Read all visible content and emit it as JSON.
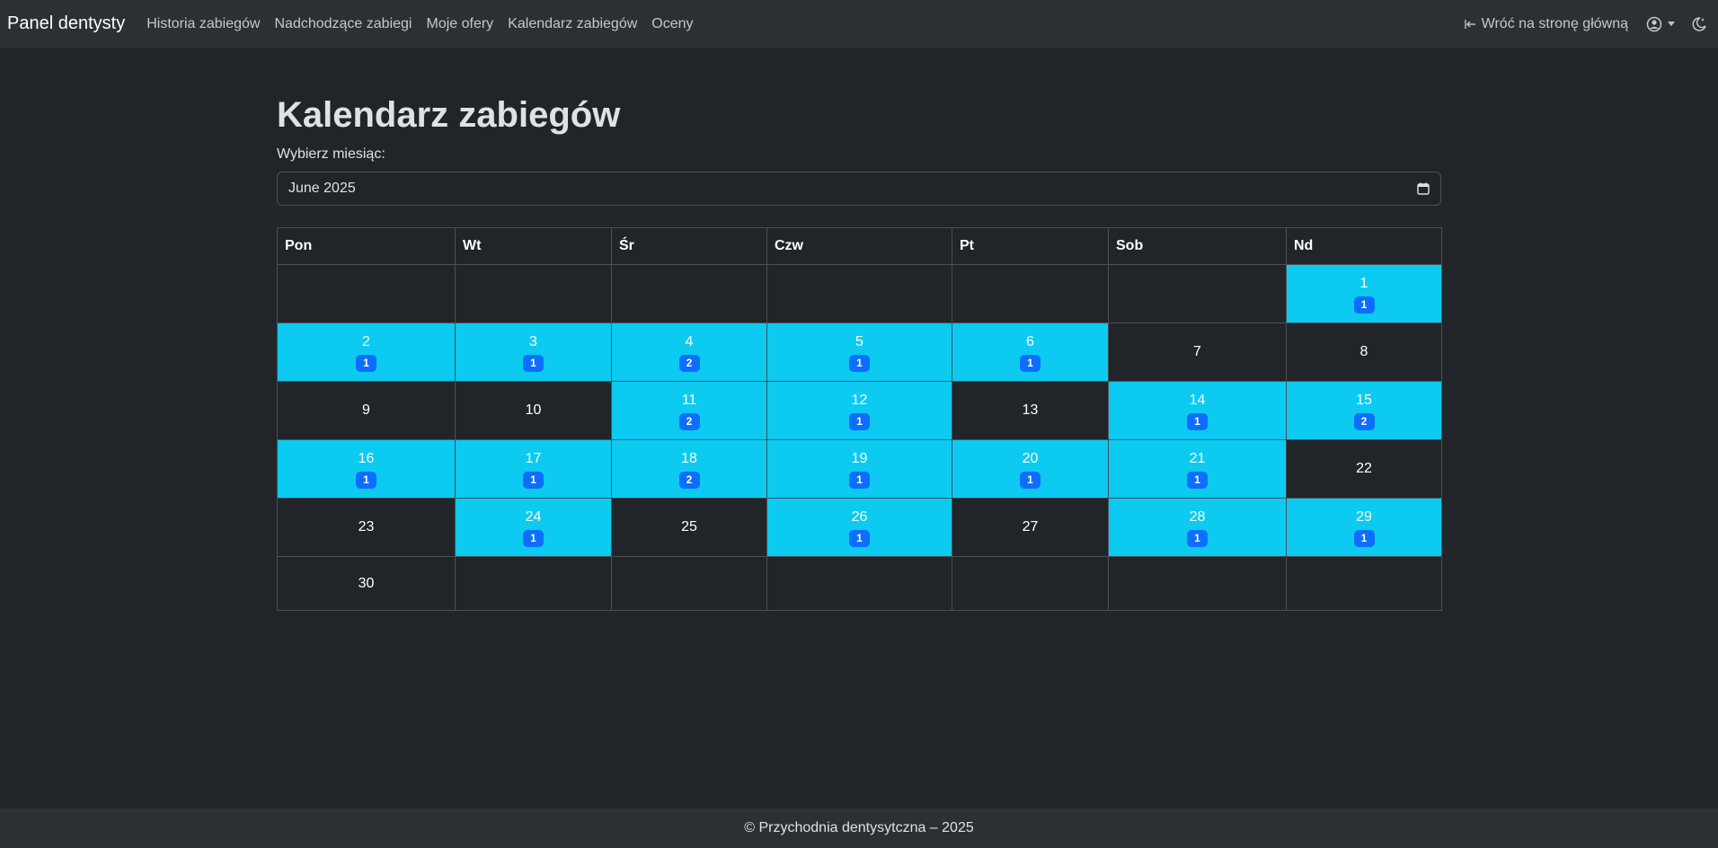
{
  "navbar": {
    "brand": "Panel dentysty",
    "links": [
      "Historia zabiegów",
      "Nadchodzące zabiegi",
      "Moje ofery",
      "Kalendarz zabiegów",
      "Oceny"
    ],
    "back_link": "Wróć na stronę główną",
    "icons": {
      "back": "arrow-left-to-line-icon",
      "user": "user-circle-icon",
      "theme": "moon-icon"
    }
  },
  "main": {
    "title": "Kalendarz zabiegów",
    "month_label": "Wybierz miesiąc:",
    "month_value": "June 2025"
  },
  "calendar": {
    "headers": [
      "Pon",
      "Wt",
      "Śr",
      "Czw",
      "Pt",
      "Sob",
      "Nd"
    ],
    "weeks": [
      [
        null,
        null,
        null,
        null,
        null,
        null,
        {
          "day": "1",
          "count": "1"
        }
      ],
      [
        {
          "day": "2",
          "count": "1"
        },
        {
          "day": "3",
          "count": "1"
        },
        {
          "day": "4",
          "count": "2"
        },
        {
          "day": "5",
          "count": "1"
        },
        {
          "day": "6",
          "count": "1"
        },
        {
          "day": "7"
        },
        {
          "day": "8"
        }
      ],
      [
        {
          "day": "9"
        },
        {
          "day": "10"
        },
        {
          "day": "11",
          "count": "2"
        },
        {
          "day": "12",
          "count": "1"
        },
        {
          "day": "13"
        },
        {
          "day": "14",
          "count": "1"
        },
        {
          "day": "15",
          "count": "2"
        }
      ],
      [
        {
          "day": "16",
          "count": "1"
        },
        {
          "day": "17",
          "count": "1"
        },
        {
          "day": "18",
          "count": "2"
        },
        {
          "day": "19",
          "count": "1"
        },
        {
          "day": "20",
          "count": "1"
        },
        {
          "day": "21",
          "count": "1"
        },
        {
          "day": "22"
        }
      ],
      [
        {
          "day": "23"
        },
        {
          "day": "24",
          "count": "1"
        },
        {
          "day": "25"
        },
        {
          "day": "26",
          "count": "1"
        },
        {
          "day": "27"
        },
        {
          "day": "28",
          "count": "1"
        },
        {
          "day": "29",
          "count": "1"
        }
      ],
      [
        {
          "day": "30"
        },
        null,
        null,
        null,
        null,
        null,
        null
      ]
    ]
  },
  "colors": {
    "busy_day": "#0dcaf0",
    "badge": "#0d6efd",
    "background": "#212529",
    "navbar": "#2b3035"
  },
  "footer": {
    "text": "© Przychodnia dentysytczna – 2025"
  }
}
